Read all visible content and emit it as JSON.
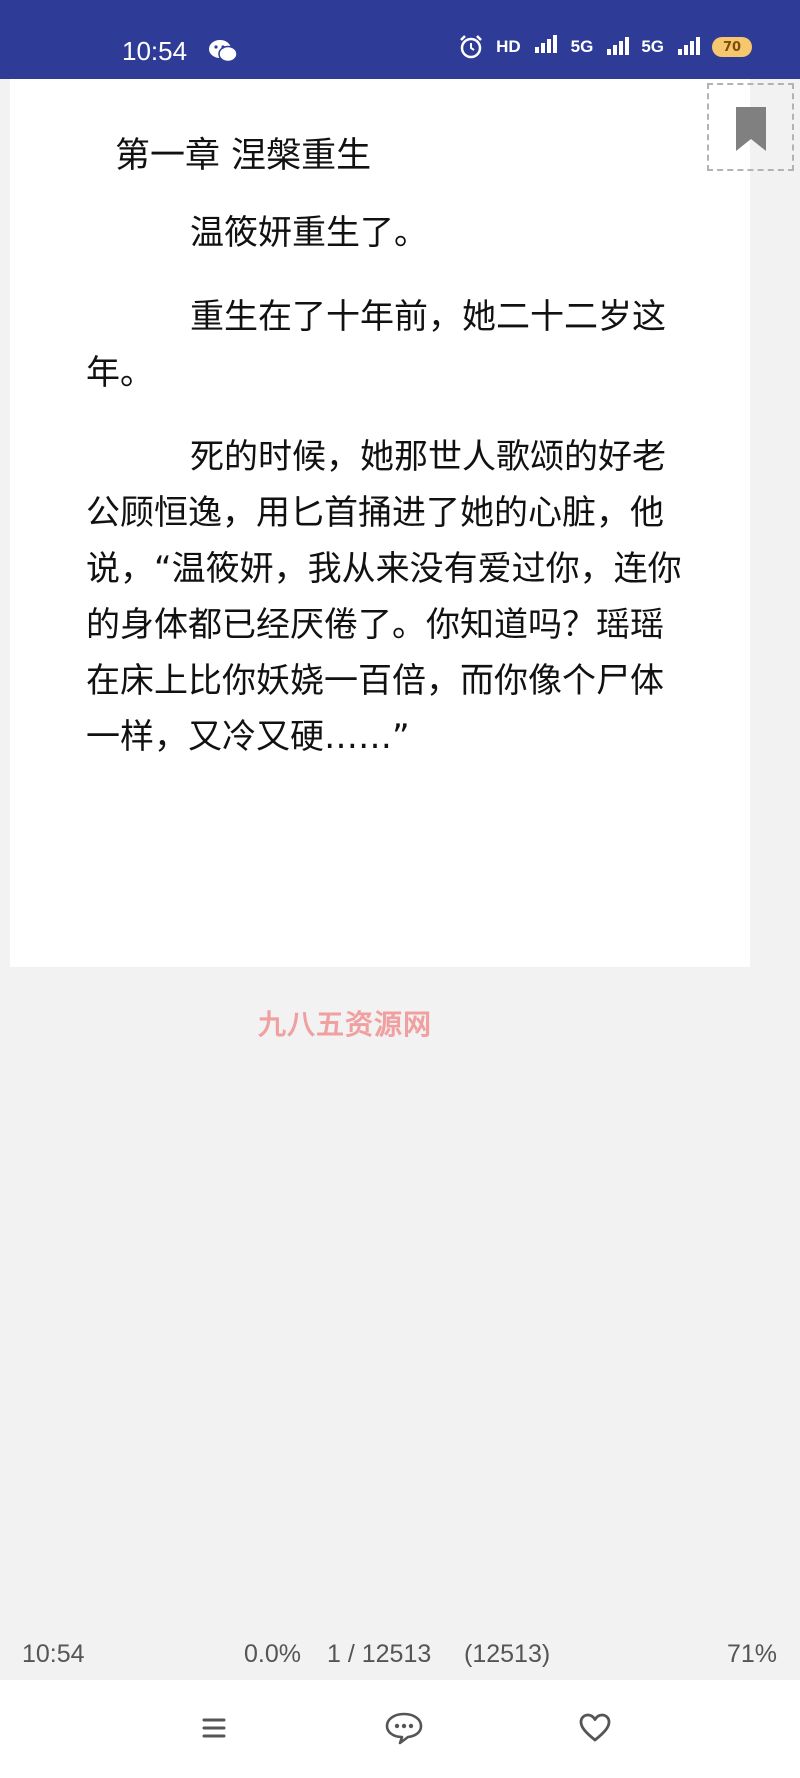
{
  "status_bar": {
    "time": "10:54",
    "icons": [
      "wechat-icon",
      "alarm-icon",
      "hd-wifi-icon",
      "hd-signal-icon",
      "5g-signal-icon",
      "5g-signal-icon",
      "battery-icon"
    ],
    "hd_label": "HD",
    "fiveg_label": "5G",
    "battery_level": "70"
  },
  "reader": {
    "chapter_title": "第一章 涅槃重生",
    "paragraphs": [
      "温筱妍重生了。",
      "重生在了十年前，她二十二岁这年。",
      "死的时候，她那世人歌颂的好老公顾恒逸，用匕首捅进了她的心脏，他说，“温筱妍，我从来没有爱过你，连你的身体都已经厌倦了。你知道吗？瑶瑶在床上比你妖娆一百倍，而你像个尸体一样，又冷又硬……”"
    ],
    "bookmark_icon": "bookmark-icon",
    "watermark": "九八五资源网"
  },
  "footer": {
    "time": "10:54",
    "progress": "0.0%",
    "page_info": "1 / 12513",
    "total_pages": "(12513)",
    "battery": "71%"
  },
  "nav": {
    "items": [
      "menu-icon",
      "chat-icon",
      "heart-icon"
    ]
  },
  "colors": {
    "status_bar_bg": "#2e3b97",
    "page_bg": "#ffffff",
    "screen_bg": "#f2f2f2",
    "watermark": "#f0a0a0"
  }
}
